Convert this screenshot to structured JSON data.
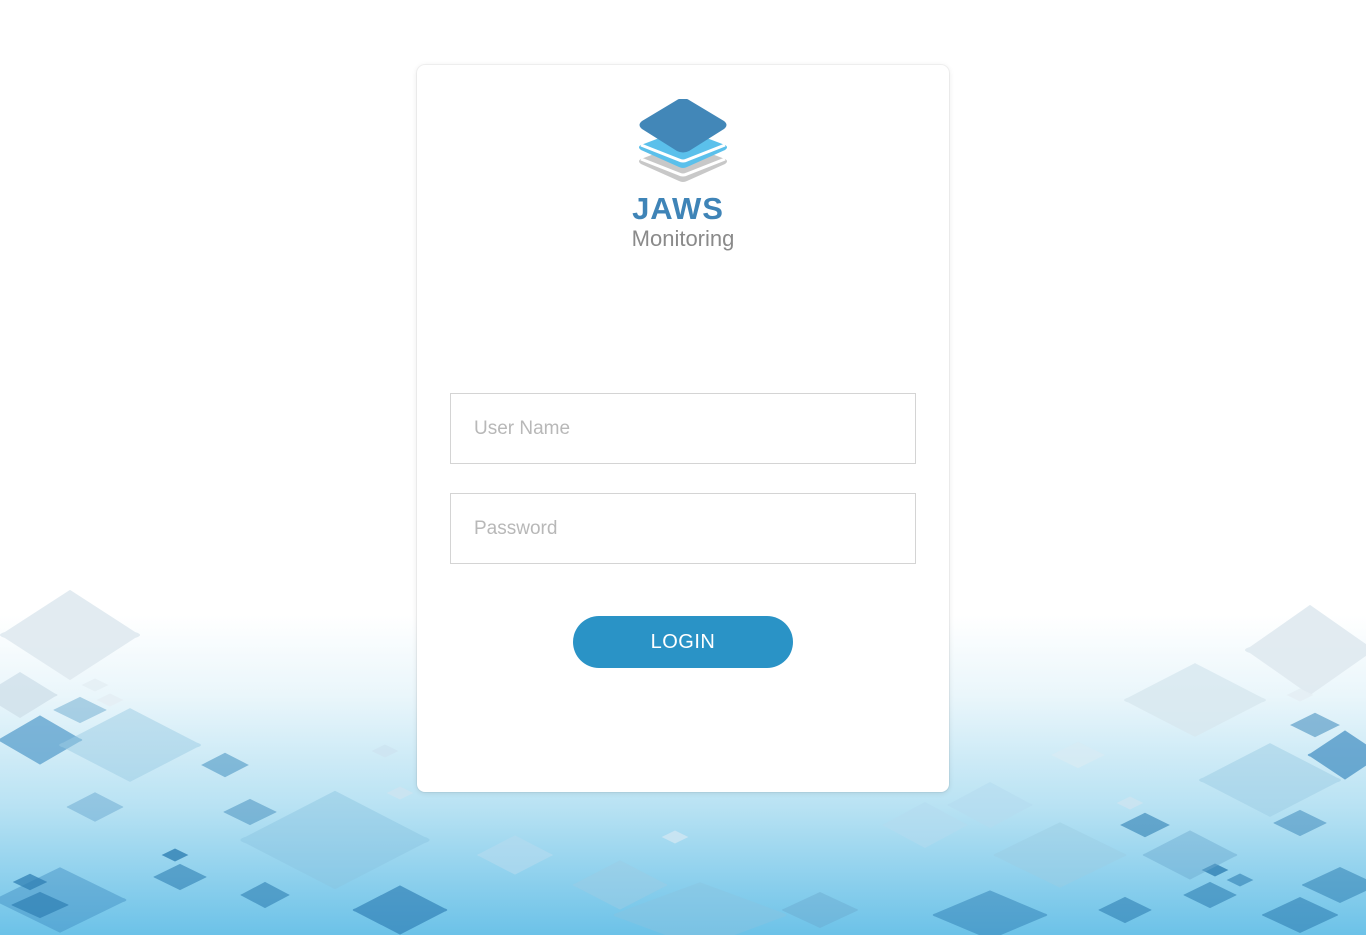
{
  "brand": {
    "name": "JAWS",
    "subtitle": "Monitoring",
    "logo_icon": "stacked-layers-icon"
  },
  "form": {
    "username_placeholder": "User Name",
    "username_value": "",
    "password_placeholder": "Password",
    "password_value": "",
    "login_label": "LOGIN"
  },
  "colors": {
    "brand_blue": "#3f84b7",
    "accent_blue": "#2a93c6",
    "light_blue": "#5bc0eb",
    "gray_layer": "#c8c8c8",
    "subtitle_gray": "#8a8a8a"
  }
}
